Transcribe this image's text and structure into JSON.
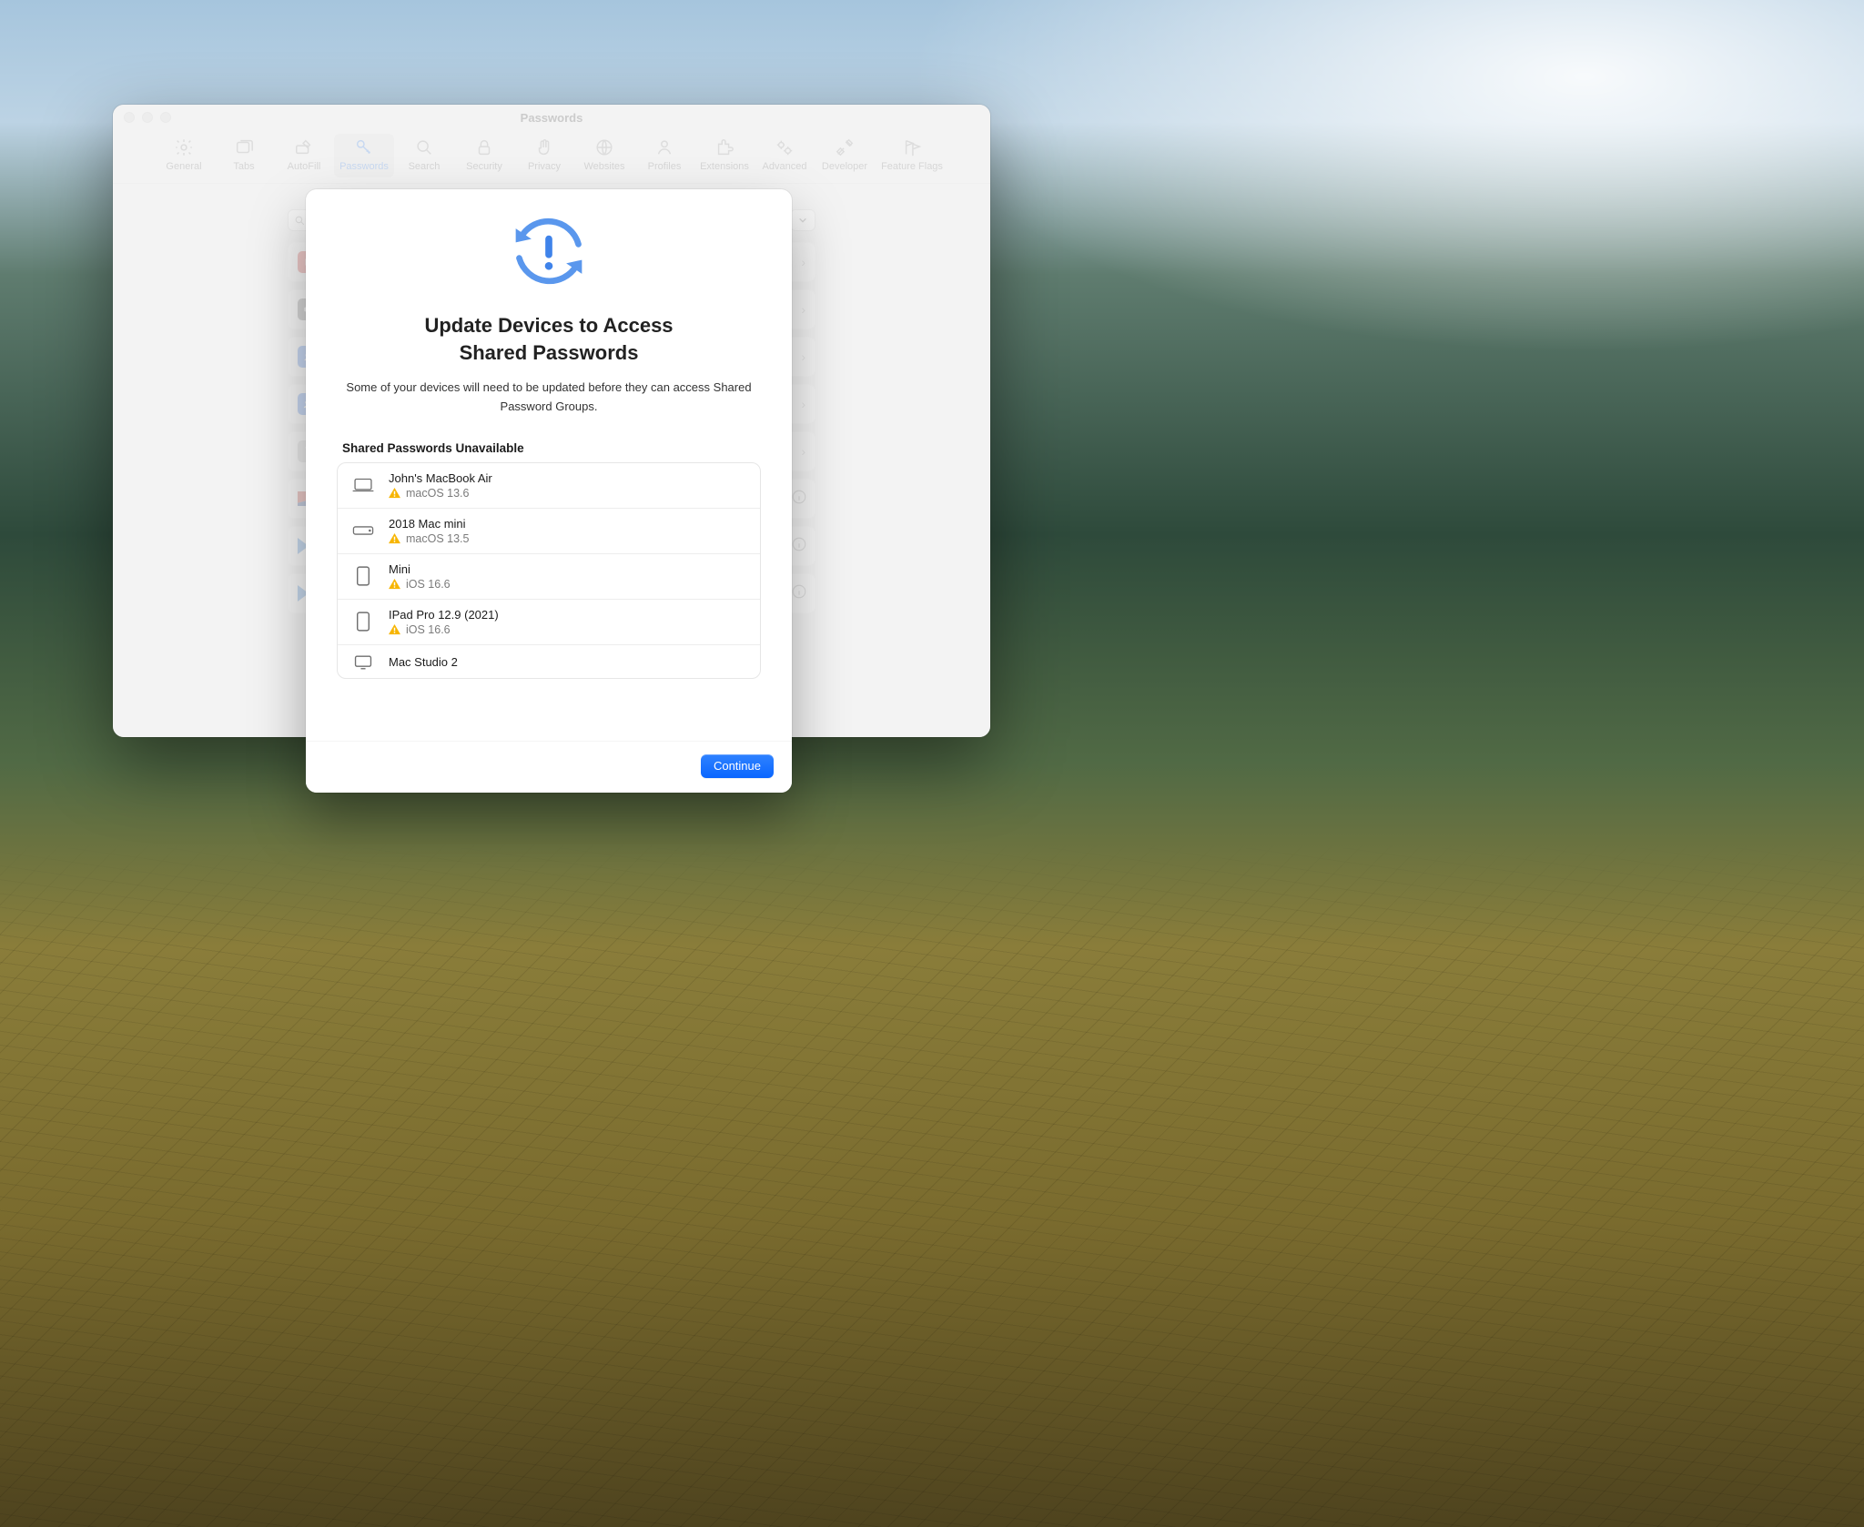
{
  "window": {
    "title": "Passwords",
    "toolbar": [
      {
        "id": "general",
        "label": "General"
      },
      {
        "id": "tabs",
        "label": "Tabs"
      },
      {
        "id": "autofill",
        "label": "AutoFill"
      },
      {
        "id": "passwords",
        "label": "Passwords",
        "active": true
      },
      {
        "id": "search",
        "label": "Search"
      },
      {
        "id": "security",
        "label": "Security"
      },
      {
        "id": "privacy",
        "label": "Privacy"
      },
      {
        "id": "websites",
        "label": "Websites"
      },
      {
        "id": "profiles",
        "label": "Profiles"
      },
      {
        "id": "extensions",
        "label": "Extensions"
      },
      {
        "id": "advanced",
        "label": "Advanced"
      },
      {
        "id": "developer",
        "label": "Developer"
      },
      {
        "id": "featureflags",
        "label": "Feature Flags"
      }
    ]
  },
  "modal": {
    "title_line1": "Update Devices to Access",
    "title_line2": "Shared Passwords",
    "description": "Some of your devices will need to be updated before they can access Shared Password Groups.",
    "section_label": "Shared Passwords Unavailable",
    "continue_label": "Continue",
    "devices": [
      {
        "name": "John's MacBook Air",
        "os": "macOS 13.6",
        "type": "laptop"
      },
      {
        "name": "2018 Mac mini",
        "os": "macOS 13.5",
        "type": "macmini"
      },
      {
        "name": "Mini",
        "os": "iOS 16.6",
        "type": "ipad"
      },
      {
        "name": "IPad Pro 12.9 (2021)",
        "os": "iOS 16.6",
        "type": "ipad"
      },
      {
        "name": "Mac Studio 2",
        "os": "",
        "type": "desktop"
      }
    ]
  }
}
